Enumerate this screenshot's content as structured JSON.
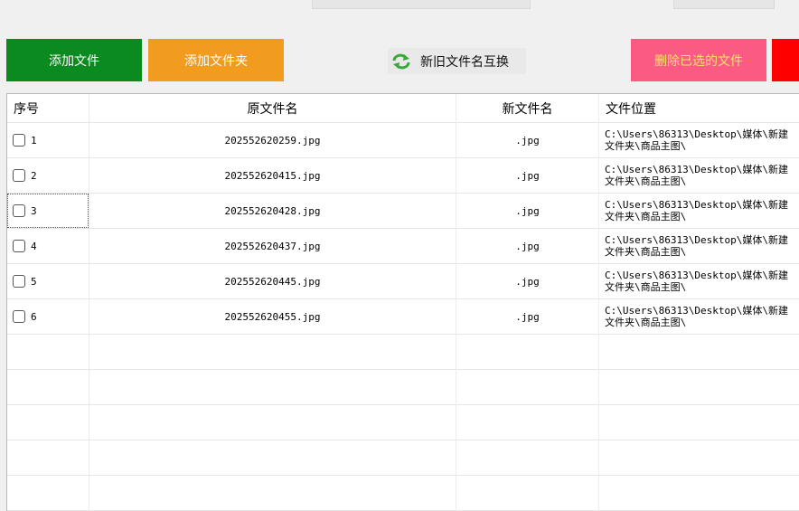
{
  "toolbar": {
    "add_file_label": "添加文件",
    "add_folder_label": "添加文件夹",
    "swap_label": "新旧文件名互换",
    "delete_selected_label": "删除已选的文件",
    "swap_icon": "refresh-swap-icon"
  },
  "colors": {
    "add_file_bg": "#0b8a1f",
    "add_folder_bg": "#f29c1f",
    "delete_bg": "#fb5b82",
    "delete_text": "#ffe36b",
    "red_button_bg": "#ff0000"
  },
  "table": {
    "columns": [
      "序号",
      "原文件名",
      "新文件名",
      "文件位置"
    ],
    "rows": [
      {
        "seq": "1",
        "orig": "202552620259.jpg",
        "new": ".jpg",
        "loc": "C:\\Users\\86313\\Desktop\\媒体\\新建文件夹\\商品主图\\"
      },
      {
        "seq": "2",
        "orig": "202552620415.jpg",
        "new": ".jpg",
        "loc": "C:\\Users\\86313\\Desktop\\媒体\\新建文件夹\\商品主图\\"
      },
      {
        "seq": "3",
        "orig": "202552620428.jpg",
        "new": ".jpg",
        "loc": "C:\\Users\\86313\\Desktop\\媒体\\新建文件夹\\商品主图\\"
      },
      {
        "seq": "4",
        "orig": "202552620437.jpg",
        "new": ".jpg",
        "loc": "C:\\Users\\86313\\Desktop\\媒体\\新建文件夹\\商品主图\\"
      },
      {
        "seq": "5",
        "orig": "202552620445.jpg",
        "new": ".jpg",
        "loc": "C:\\Users\\86313\\Desktop\\媒体\\新建文件夹\\商品主图\\"
      },
      {
        "seq": "6",
        "orig": "202552620455.jpg",
        "new": ".jpg",
        "loc": "C:\\Users\\86313\\Desktop\\媒体\\新建文件夹\\商品主图\\"
      }
    ]
  }
}
